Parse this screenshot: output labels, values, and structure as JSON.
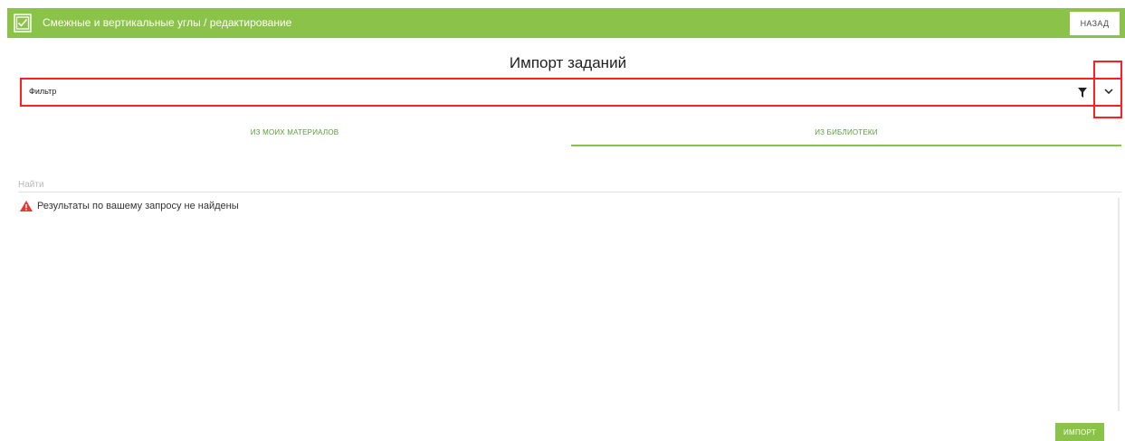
{
  "header": {
    "title": "Смежные и вертикальные углы / редактирование",
    "back_label": "НАЗАД",
    "app_icon": "checkbox-icon",
    "bg_color": "#8bc34a"
  },
  "page": {
    "title": "Импорт заданий"
  },
  "filter": {
    "label": "Фильтр",
    "filter_icon": "funnel-icon",
    "expand_icon": "chevron-down-icon"
  },
  "tabs": [
    {
      "label": "ИЗ МОИХ МАТЕРИАЛОВ",
      "active": false
    },
    {
      "label": "ИЗ БИБЛИОТЕКИ",
      "active": true
    }
  ],
  "search": {
    "placeholder": "Найти",
    "value": ""
  },
  "results": {
    "empty_message": "Результаты по вашему запросу не найдены",
    "warning_icon": "warning-triangle-icon",
    "warning_color": "#e53935"
  },
  "footer": {
    "import_label": "ИМПОРТ"
  },
  "highlight_color": "#ff1f1f",
  "accent_color": "#8bc34a"
}
